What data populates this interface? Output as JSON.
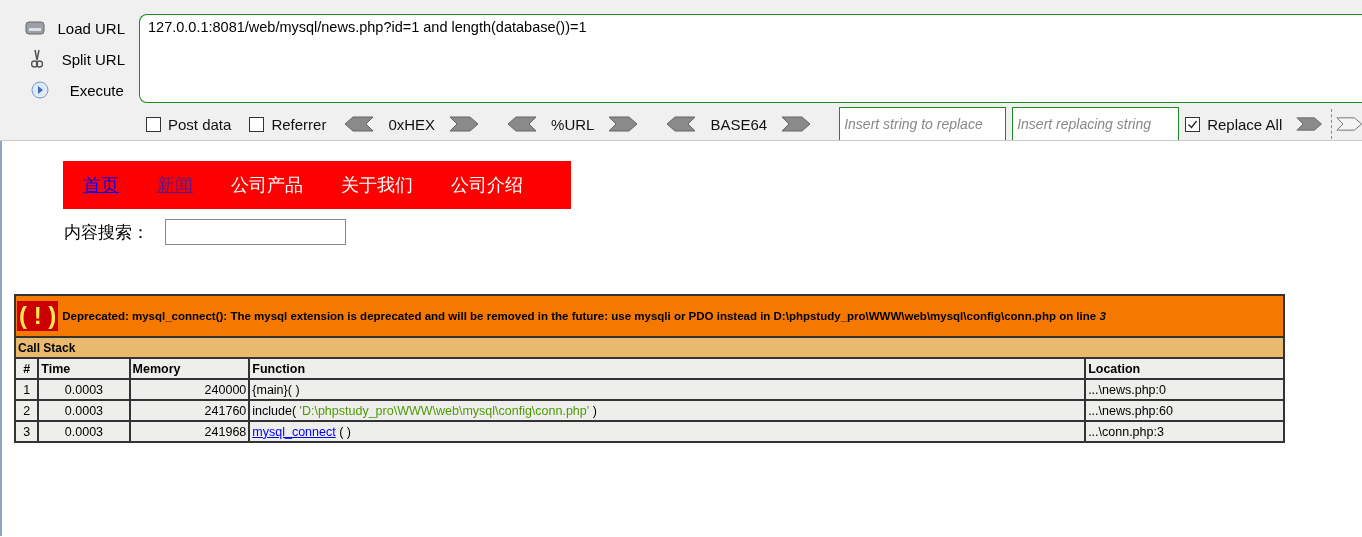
{
  "hackbar": {
    "actions": [
      {
        "label": "Load URL",
        "kind": "load"
      },
      {
        "label": "Split URL",
        "kind": "split"
      },
      {
        "label": "Execute",
        "kind": "execute"
      }
    ],
    "url": "127.0.0.1:8081/web/mysql/news.php?id=1 and length(database())=1",
    "post_data": {
      "label": "Post data",
      "checked": false
    },
    "referrer": {
      "label": "Referrer",
      "checked": false
    },
    "encoders": [
      "0xHEX",
      "%URL",
      "BASE64"
    ],
    "replace_from": {
      "placeholder": "Insert string to replace"
    },
    "replace_to": {
      "placeholder": "Insert replacing string"
    },
    "replace_all": {
      "label": "Replace All",
      "checked": true
    }
  },
  "site": {
    "nav": [
      {
        "label": "首页",
        "kind": "link"
      },
      {
        "label": "新闻",
        "kind": "visited"
      },
      {
        "label": "公司产品",
        "kind": "text"
      },
      {
        "label": "关于我们",
        "kind": "text"
      },
      {
        "label": "公司介绍",
        "kind": "text"
      }
    ],
    "search_label": "内容搜索："
  },
  "error": {
    "icon": "( ! )",
    "message": "Deprecated: mysql_connect(): The mysql extension is deprecated and will be removed in the future: use mysqli or PDO instead in D:\\phpstudy_pro\\WWW\\web\\mysql\\config\\conn.php on line *3*",
    "stack_title": "Call Stack",
    "columns": [
      "#",
      "Time",
      "Memory",
      "Function",
      "Location"
    ],
    "rows": [
      {
        "index": "1",
        "time": "0.0003",
        "memory": "240000",
        "function": [
          {
            "kind": "plain",
            "text": "{main}( )"
          }
        ],
        "location": "...\\news.php:0"
      },
      {
        "index": "2",
        "time": "0.0003",
        "memory": "241760",
        "function": [
          {
            "kind": "plain",
            "text": "include( "
          },
          {
            "kind": "string",
            "text": "'D:\\phpstudy_pro\\WWW\\web\\mysql\\config\\conn.php'"
          },
          {
            "kind": "plain",
            "text": " )"
          }
        ],
        "location": "...\\news.php:60"
      },
      {
        "index": "3",
        "time": "0.0003",
        "memory": "241968",
        "function": [
          {
            "kind": "link",
            "text": "mysql_connect"
          },
          {
            "kind": "plain",
            "text": " ( )"
          }
        ],
        "location": "...\\conn.php:3"
      }
    ]
  }
}
